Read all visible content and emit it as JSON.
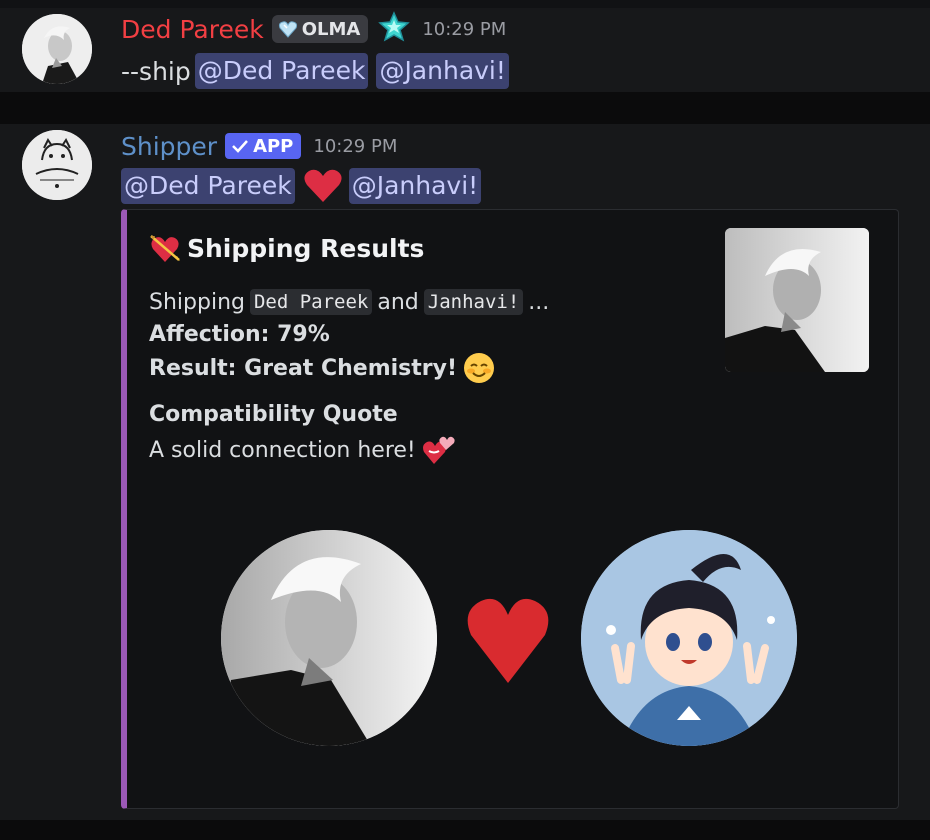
{
  "messages": [
    {
      "username": "Ded Pareek",
      "guild_tag": "OLMA",
      "timestamp": "10:29 PM",
      "text_prefix": "--ship",
      "mentions": [
        "@Ded Pareek",
        "@Janhavi!"
      ]
    },
    {
      "username": "Shipper",
      "app_badge": "APP",
      "timestamp": "10:29 PM",
      "mentions": [
        "@Ded Pareek",
        "@Janhavi!"
      ],
      "embed": {
        "accent_color": "#9b59b6",
        "title": "Shipping Results",
        "shipping_prefix": "Shipping",
        "name_a": "Ded Pareek",
        "conjunction": "and",
        "name_b": "Janhavi!",
        "ellipsis": "...",
        "affection": "Affection: 79%",
        "result": "Result: Great Chemistry!",
        "quote_title": "Compatibility Quote",
        "quote_text": "A solid connection here!"
      }
    }
  ],
  "colors": {
    "username_1": "#f23f43",
    "username_2": "#5e90c9",
    "mention_bg": "#3c4270",
    "app_badge": "#5865f2"
  },
  "icons": {
    "guild_tag": "heart-gem-icon",
    "nitro": "star-badge-icon",
    "verified": "check-icon",
    "title_emoji": "heart-arrow-icon",
    "result_emoji": "smiling-face-icon",
    "quote_emoji": "kiss-hearts-icon",
    "separator": "red-heart-icon"
  }
}
